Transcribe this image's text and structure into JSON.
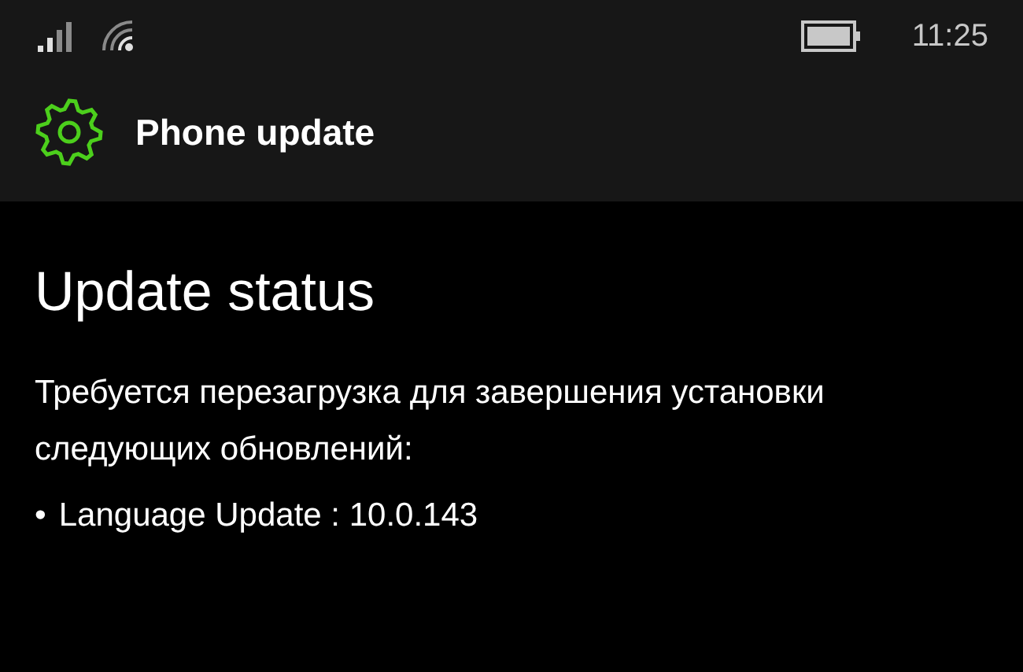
{
  "status_bar": {
    "time": "11:25"
  },
  "header": {
    "title": "Phone update"
  },
  "content": {
    "heading": "Update status",
    "message": "Требуется перезагрузка для завершения установки следующих обновлений:",
    "updates": [
      {
        "bullet": "•",
        "text": "Language Update : 10.0.143"
      }
    ]
  }
}
